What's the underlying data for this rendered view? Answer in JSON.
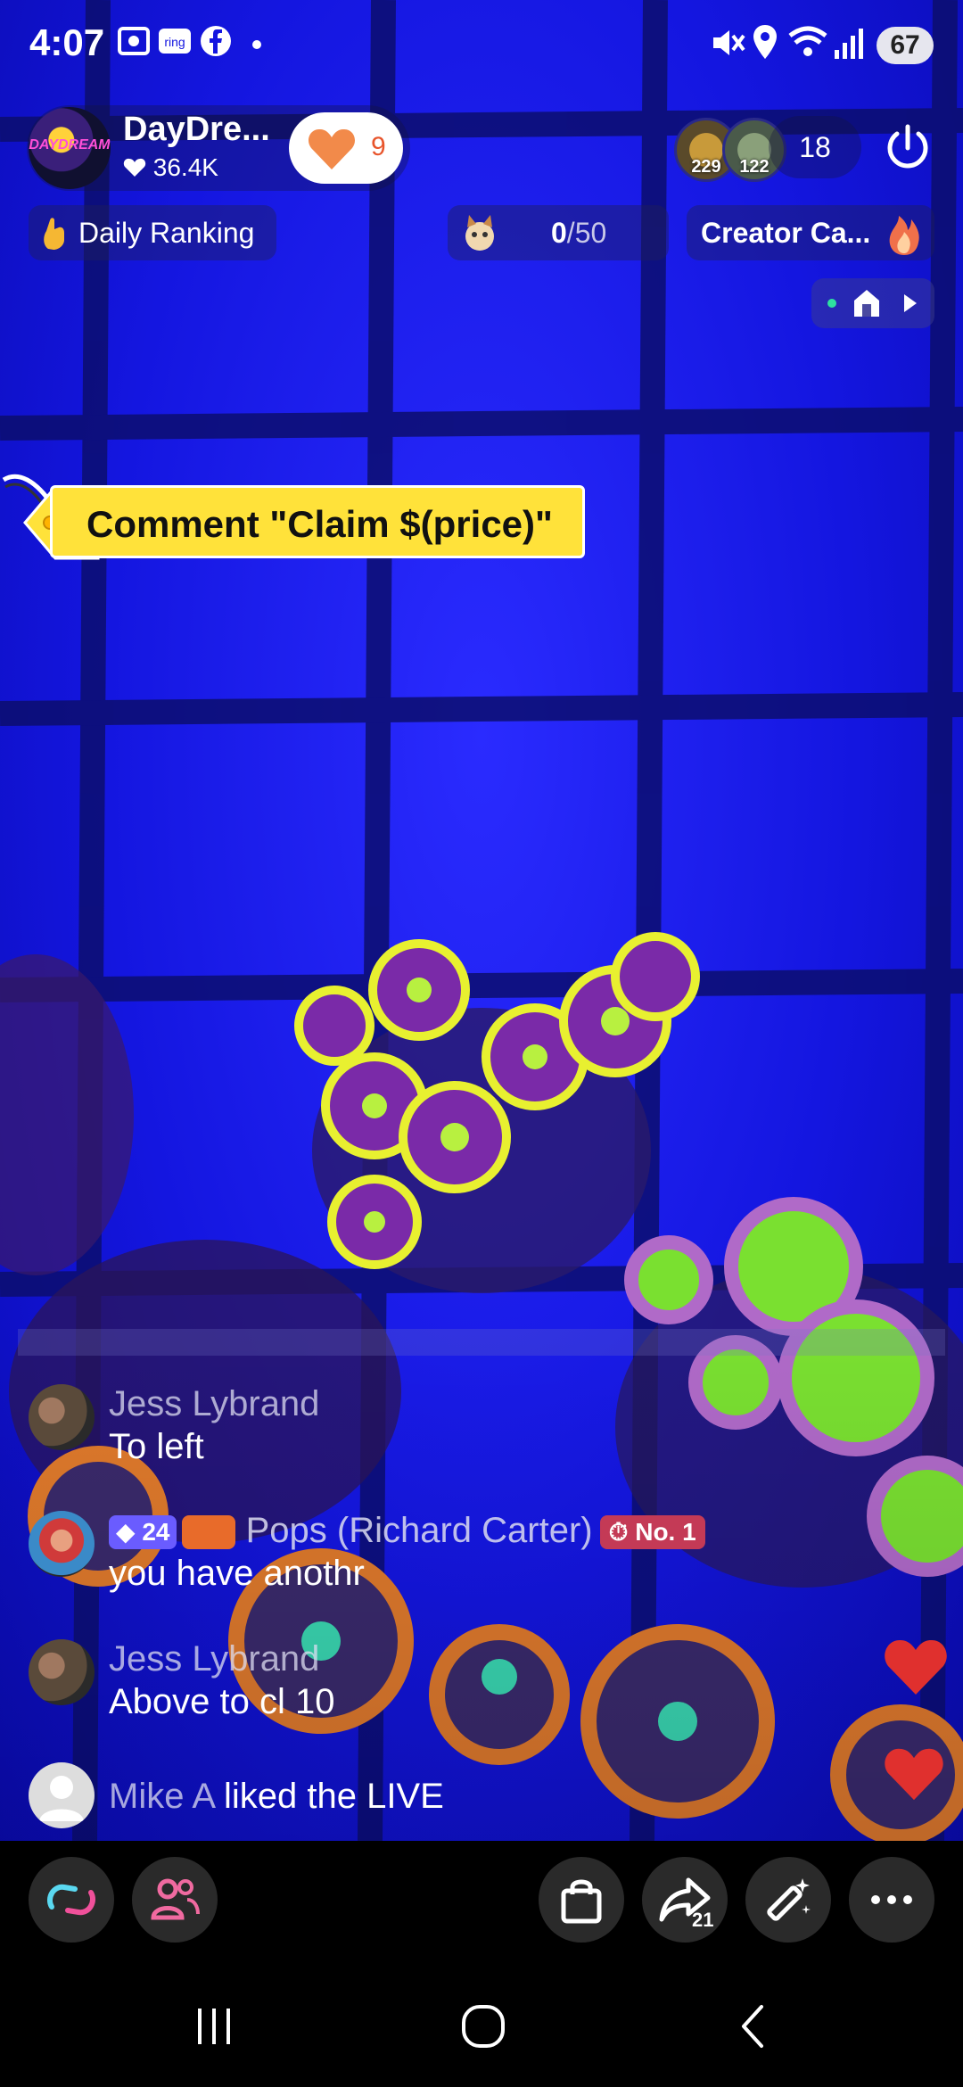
{
  "status_bar": {
    "time": "4:07",
    "battery": "67"
  },
  "host": {
    "name": "DayDre...",
    "likes": "36.4K",
    "follow_count": "9",
    "avatar_text": "DAYDREAM"
  },
  "viewers": {
    "top1_score": "229",
    "top2_score": "122",
    "count": "18"
  },
  "chips": {
    "daily_ranking": "Daily Ranking",
    "goal_current": "0",
    "goal_total": "/50",
    "creator": "Creator Ca..."
  },
  "claim_tag": {
    "text": "Comment \"Claim $(price)\""
  },
  "comments": [
    {
      "name": "Jess Lybrand",
      "text": "To left"
    },
    {
      "level": "24",
      "name": "Pops (Richard Carter)",
      "rank": "No. 1",
      "text": "you have anothr"
    },
    {
      "name": "Jess Lybrand",
      "text": "Above to cl 10"
    },
    {
      "name": "Mike A",
      "text": "liked the LIVE"
    }
  ],
  "bottom_bar": {
    "share_count": "21"
  },
  "colors": {
    "stream_blue": "#1416e0",
    "claim_yellow": "#ffe23a",
    "heart_red": "#e0302e",
    "follow_orange": "#f28a4a"
  },
  "icons": [
    "collab-icon",
    "guests-icon",
    "shop-bag-icon",
    "share-icon",
    "magic-wand-icon",
    "more-icon",
    "power-icon",
    "fire-icon",
    "heart-icon"
  ]
}
